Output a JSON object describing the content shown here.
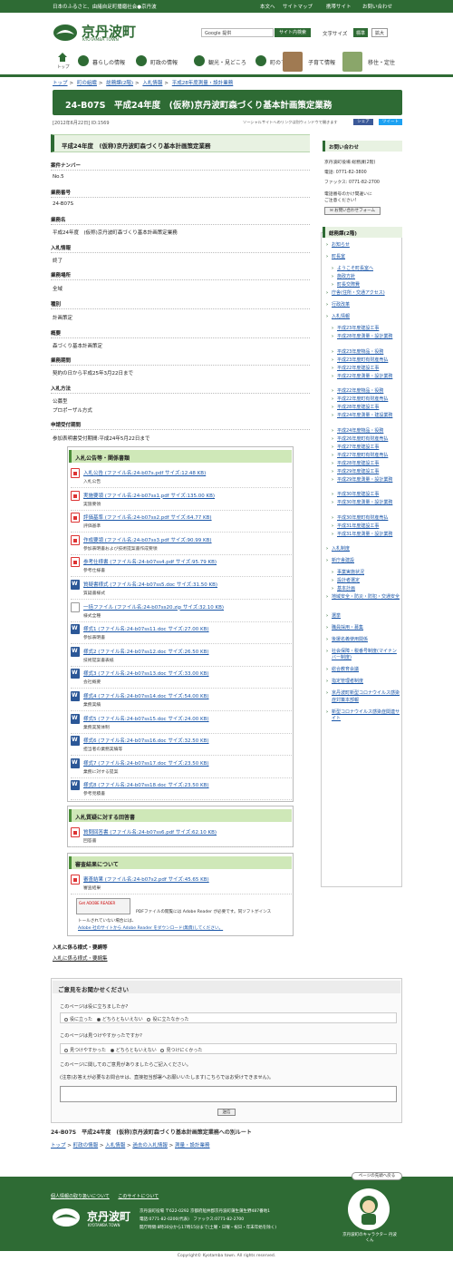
{
  "topbar": {
    "tagline": "日本のふるさと、由緒自足町播磨社会●京丹波",
    "links": [
      "本文へ",
      "サイトマップ",
      "携帯サイト",
      "お問い合わせ"
    ]
  },
  "header": {
    "logo": "京丹波町",
    "logo_sub": "KYOTAMBA TOWN",
    "search_placeholder": "Google 提供",
    "search_button": "サイト内検索",
    "font_size_label": "文字サイズ",
    "font_std": "標準",
    "font_large": "拡大"
  },
  "gnav": [
    {
      "label": "トップ"
    },
    {
      "label": "暮らしの情報"
    },
    {
      "label": "町政の情報"
    },
    {
      "label": "観光・見どころ"
    },
    {
      "label": "町のすがた"
    },
    {
      "label": "子育て情報"
    },
    {
      "label": "移住・定住"
    }
  ],
  "breadcrumb": [
    "トップ",
    ">",
    "町の組織",
    ">",
    "総務課(2階)",
    ">",
    "入札情報",
    ">",
    "平成28年度測量・設計業務"
  ],
  "page": {
    "title": "24-B07S　平成24年度　(仮称)京丹波町森づくり基本計画策定業務",
    "date": "[2012年6月22日]",
    "id": "ID:1569",
    "social_note": "ソーシャルサイトへのリンクは別ウィンドウで開きます",
    "fb": "シェア",
    "tw": "ツイート"
  },
  "content": {
    "heading": "平成24年度　(仮称)京丹波町森づくり基本計画策定業務",
    "fields": [
      {
        "label": "案件ナンバー",
        "value": "No.5"
      },
      {
        "label": "業務番号",
        "value": "24-B07S"
      },
      {
        "label": "業務名",
        "value": "平成24年度　(仮称)京丹波町森づくり基本計画策定業務"
      },
      {
        "label": "入札情報",
        "value": "終了"
      },
      {
        "label": "業務場所",
        "value": "全域"
      },
      {
        "label": "種別",
        "value": "計画策定"
      },
      {
        "label": "概要",
        "value": "森づくり基本計画策定"
      },
      {
        "label": "業務期間",
        "value": "契約の日から平成25年3月22日まで"
      },
      {
        "label": "入札方法",
        "value": "公募型"
      },
      {
        "label": "申請受付期間",
        "value": "参加表明書受付期間:平成24年5月22日まで"
      }
    ],
    "method_extra": "プロポーザル方式",
    "section1": {
      "heading": "入札公告等・関係書類",
      "files": [
        {
          "name": "入札公告 (ファイル名:24-b07s.pdf サイズ:12.48 KB)",
          "desc": "入札公告",
          "type": "pdf"
        },
        {
          "name": "実施要領 (ファイル名:24-b07ss1.pdf サイズ:135.00 KB)",
          "desc": "実施要領",
          "type": "pdf"
        },
        {
          "name": "評価基準 (ファイル名:24-b07ss2.pdf サイズ:64.77 KB)",
          "desc": "評価基準",
          "type": "pdf"
        },
        {
          "name": "作成要領 (ファイル名:24-b07ss3.pdf サイズ:90.99 KB)",
          "desc": "参加表明書および技術提案書作成要領",
          "type": "pdf"
        },
        {
          "name": "参考仕様書 (ファイル名:24-b07ss4.pdf サイズ:95.79 KB)",
          "desc": "参考仕様書",
          "type": "pdf"
        },
        {
          "name": "質疑書様式 (ファイル名:24-b07ss5.doc サイズ:31.50 KB)",
          "desc": "質疑書様式",
          "type": "doc"
        },
        {
          "name": "一括ファイル (ファイル名:24-b07ss20.zip サイズ:32.10 KB)",
          "desc": "様式全種",
          "type": "zip"
        },
        {
          "name": "様式1 (ファイル名:24-b07ss11.doc サイズ:27.00 KB)",
          "desc": "参加表明書",
          "type": "doc"
        },
        {
          "name": "様式2 (ファイル名:24-b07ss12.doc サイズ:26.50 KB)",
          "desc": "技術提案書表紙",
          "type": "doc"
        },
        {
          "name": "様式3 (ファイル名:24-b07ss13.doc サイズ:33.00 KB)",
          "desc": "会社概要",
          "type": "doc"
        },
        {
          "name": "様式4 (ファイル名:24-b07ss14.doc サイズ:54.00 KB)",
          "desc": "業務実績",
          "type": "doc"
        },
        {
          "name": "様式5 (ファイル名:24-b07ss15.doc サイズ:24.00 KB)",
          "desc": "業務実施体制",
          "type": "doc"
        },
        {
          "name": "様式6 (ファイル名:24-b07ss16.doc サイズ:32.50 KB)",
          "desc": "担当者の業務実績等",
          "type": "doc"
        },
        {
          "name": "様式7 (ファイル名:24-b07ss17.doc サイズ:23.50 KB)",
          "desc": "業務に対する提案",
          "type": "doc"
        },
        {
          "name": "様式8 (ファイル名:24-b07ss18.doc サイズ:23.50 KB)",
          "desc": "参考見積書",
          "type": "doc"
        }
      ]
    },
    "section2": {
      "heading": "入札質疑に対する回答書",
      "files": [
        {
          "name": "質問回答書 (ファイル名:24-b07ss6.pdf サイズ:62.10 KB)",
          "desc": "回答書",
          "type": "pdf"
        }
      ]
    },
    "section3": {
      "heading": "審査結果について",
      "files": [
        {
          "name": "審査結果 (ファイル名:24-b07s2.pdf サイズ:45.65 KB)",
          "desc": "審査結果",
          "type": "pdf"
        }
      ]
    },
    "adobe": {
      "logo": "Get ADOBE READER",
      "line1": "PDFファイルの閲覧には Adobe Reader が必要です。同ソフトがインス",
      "line2": "トールされていない場合には、",
      "line3": "Adobe 社のサイトから Adobe Reader をダウンロード(無償)してください。"
    },
    "forms_heading": "入札に係る様式・要綱等",
    "forms_link": "入札に係る様式・要綱集"
  },
  "sidebar": {
    "contact_heading": "お問い合わせ",
    "contact_lines": [
      "京丹波町役場 総務課(2階)",
      "電話: 0771-82-3800",
      "ファックス: 0771-82-2700",
      "電話番号のかけ間違いに",
      "ご注意ください!"
    ],
    "mail_button": "お問い合わせフォーム",
    "nav_heading": "総務課(2階)",
    "items": [
      {
        "label": "お知らせ",
        "sub": false
      },
      {
        "label": "町長室",
        "sub": false
      },
      {
        "label": "ようこそ町長室へ",
        "sub": true
      },
      {
        "label": "施政方針",
        "sub": true
      },
      {
        "label": "町長交際費",
        "sub": true
      },
      {
        "label": "庁舎(住所・交通アクセス)",
        "sub": false
      },
      {
        "label": "行政改革",
        "sub": false
      },
      {
        "label": "入札情報",
        "sub": false
      },
      {
        "label": "平成23年度建設工事",
        "sub": true
      },
      {
        "label": "平成28年度測量・設計業務",
        "sub": true
      },
      {
        "label": "平成23年度物品・役務",
        "sub": true
      },
      {
        "label": "平成23年度町有財産売払",
        "sub": true
      },
      {
        "label": "平成22年度建設工事",
        "sub": true
      },
      {
        "label": "平成22年度測量・設計業務",
        "sub": true
      },
      {
        "label": "平成22年度物品・役務",
        "sub": true
      },
      {
        "label": "平成22年度町有財産売払",
        "sub": true
      },
      {
        "label": "平成28年度建設工事",
        "sub": true
      },
      {
        "label": "平成24年度測量・建設業務",
        "sub": true
      },
      {
        "label": "平成24年度物品・役務",
        "sub": true
      },
      {
        "label": "平成26年度町有財産売払",
        "sub": true
      },
      {
        "label": "平成27年度建設工事",
        "sub": true
      },
      {
        "label": "平成27年度町有財産売払",
        "sub": true
      },
      {
        "label": "平成28年度建設工事",
        "sub": true
      },
      {
        "label": "平成29年度建設工事",
        "sub": true
      },
      {
        "label": "平成29年度測量・設計業務",
        "sub": true
      },
      {
        "label": "平成30年度建設工事",
        "sub": true
      },
      {
        "label": "平成30年度測量・設計業務",
        "sub": true
      },
      {
        "label": "平成30年度町有財産売払",
        "sub": true
      },
      {
        "label": "平成31年度建設工事",
        "sub": true
      },
      {
        "label": "平成31年度測量・設計業務",
        "sub": true
      },
      {
        "label": "入札制度",
        "sub": false
      },
      {
        "label": "新庁舎建設",
        "sub": false
      },
      {
        "label": "事業実施状況",
        "sub": true
      },
      {
        "label": "設計者選定",
        "sub": true
      },
      {
        "label": "基本計画",
        "sub": true
      },
      {
        "label": "地域安全・防災・防犯・交通安全",
        "sub": false
      },
      {
        "label": "選挙",
        "sub": false
      },
      {
        "label": "職員採用・募集",
        "sub": false
      },
      {
        "label": "後援名義使用関係",
        "sub": false
      },
      {
        "label": "社会保障・税番号制度(マイナンバー制度)",
        "sub": false
      },
      {
        "label": "総合教育会議",
        "sub": false
      },
      {
        "label": "指定管理者制度",
        "sub": false
      },
      {
        "label": "京丹波町新型コロナウイルス感染症対策本部報",
        "sub": false
      },
      {
        "label": "新型コロナウイルス感染症関連サイト",
        "sub": false
      }
    ]
  },
  "feedback": {
    "heading": "ご意見をお聞かせください",
    "q1": "このページは役に立ちましたか?",
    "q1_opts": [
      "役に立った",
      "どちらともいえない",
      "役に立たなかった"
    ],
    "q2": "このページは見つけやすかったですか?",
    "q2_opts": [
      "見つけやすかった",
      "どちらともいえない",
      "見つけにくかった"
    ],
    "q3": "このページに関してのご意見がありましたらご記入ください。",
    "note": "(注意)お答えが必要なお問合せは、直接担当部署へお願いいたします(こちらではお受けできません)。",
    "send": "送信"
  },
  "bottom": {
    "title": "24-B07S　平成24年度　(仮称)京丹波町森づくり基本計画策定業務への別ルート",
    "crumb": [
      "トップ",
      ">",
      "町政の情報",
      ">",
      "入札情報",
      ">",
      "過去の入札情報",
      ">",
      "測量・設計業務"
    ],
    "pagetop": "ページの先頭へ戻る"
  },
  "footer": {
    "links": [
      "個人情報の取り扱いについて",
      "このサイトについて"
    ],
    "name": "京丹波町",
    "name_sub": "KYOTAMBA TOWN",
    "addr1": "京丹波町役場  〒622-0292 京都府船井郡京丹波町蒲生蒲生野487番地1",
    "addr2": "電話:0771-82-0200(代表)　ファックス:0771-82-2700",
    "addr3": "開庁時間:8時30分から17時15分まで(土曜・日曜・祝日・年末年始を除く)",
    "mascot_caption": "京丹波町のキャラクター 丹波くん",
    "copyright": "Copyright© Kyotamba town. All rights reserved."
  },
  "colors": {
    "brand": "#2e6b34",
    "link": "#1a56a8",
    "heading_bg": "#e8f2e2",
    "attachment_head": "#cfe8b8"
  }
}
